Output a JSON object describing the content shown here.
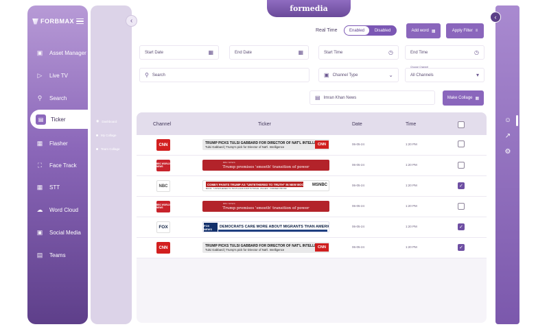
{
  "app": {
    "brand": "formedia",
    "logo_text": "FORBMAX"
  },
  "nav": {
    "items": [
      {
        "label": "Asset Manager",
        "icon": "folder-icon"
      },
      {
        "label": "Live TV",
        "icon": "play-icon"
      },
      {
        "label": "Search",
        "icon": "search-icon"
      },
      {
        "label": "Ticker",
        "icon": "ticker-icon",
        "active": true
      },
      {
        "label": "Flasher",
        "icon": "flasher-icon"
      },
      {
        "label": "Face Track",
        "icon": "face-track-icon"
      },
      {
        "label": "STT",
        "icon": "stt-icon"
      },
      {
        "label": "Word Cloud",
        "icon": "cloud-icon"
      },
      {
        "label": "Social Media",
        "icon": "social-icon"
      },
      {
        "label": "Teams",
        "icon": "teams-icon"
      }
    ]
  },
  "subnav": {
    "items": [
      "Dashboard",
      "My Collage",
      "Team Collage"
    ]
  },
  "controls": {
    "realtime_label": "Real Time",
    "toggle_on": "Enabled",
    "toggle_off": "Disabled",
    "add_word": "Add word",
    "apply_filter": "Apply Filter",
    "start_date": "Start Date",
    "end_date": "End Date",
    "start_time": "Start Time",
    "end_time": "End Time",
    "search_placeholder": "Search",
    "channel_type": "Channel Type",
    "choose_channel_label": "Choose Channel",
    "channel_value": "All Channels",
    "keyword_chip": "Imran Khan News",
    "make_collage": "Make Collage"
  },
  "table": {
    "headers": [
      "Channel",
      "Ticker",
      "Date",
      "Time"
    ],
    "rows": [
      {
        "channel": "CNN",
        "ticker_type": "cnn",
        "line1": "TRUMP PICKS TULSI GABBARD FOR DIRECTOR OF NAT'L INTELLIGENCE",
        "line2": "Tulsi Gabbard  |  Trump's pick for Director of Nat'l. Intelligence",
        "date": "06-05-24",
        "time": "1:20 PM",
        "checked": false
      },
      {
        "channel": "BBC WORLD NEWS",
        "ticker_type": "bbc",
        "line1": "Trump promises 'smooth' transition of power",
        "line2": "BBC NEWS",
        "date": "06-05-24",
        "time": "1:20 PM",
        "checked": false
      },
      {
        "channel": "NBC",
        "ticker_type": "msnbc",
        "line1": "COMEY PAINTS TRUMP AS \"UNTETHERED TO TRUTH\" IN NEW BOOK",
        "line2": "BOOK: \"UNTETHERED TO TRUTH AND INSTITUTIONAL VALUES\", FORMER FBI DIR.",
        "brand": "MSNBC",
        "date": "06-05-24",
        "time": "1:20 PM",
        "checked": true
      },
      {
        "channel": "BBC WORLD NEWS",
        "ticker_type": "bbc",
        "line1": "Trump promises 'smooth' transition of power",
        "line2": "BBC NEWS",
        "date": "06-05-24",
        "time": "1:20 PM",
        "checked": false
      },
      {
        "channel": "FOX",
        "ticker_type": "fox",
        "line1": "DEMOCRATS CARE MORE ABOUT MIGRANTS THAN AMERICANS",
        "brand": "FOX NEWS",
        "date": "06-05-24",
        "time": "1:20 PM",
        "checked": true
      },
      {
        "channel": "CNN",
        "ticker_type": "cnn",
        "line1": "TRUMP PICKS TULSI GABBARD FOR DIRECTOR OF NAT'L INTELLIGENCE",
        "line2": "Tulsi Gabbard  |  Trump's pick for Director of Nat'l. Intelligence",
        "date": "06-05-24",
        "time": "1:20 PM",
        "checked": true
      }
    ]
  },
  "colors": {
    "accent": "#8a66bc",
    "sidebar_dark": "#5e3f8a",
    "checkbox": "#6e4fa3"
  }
}
